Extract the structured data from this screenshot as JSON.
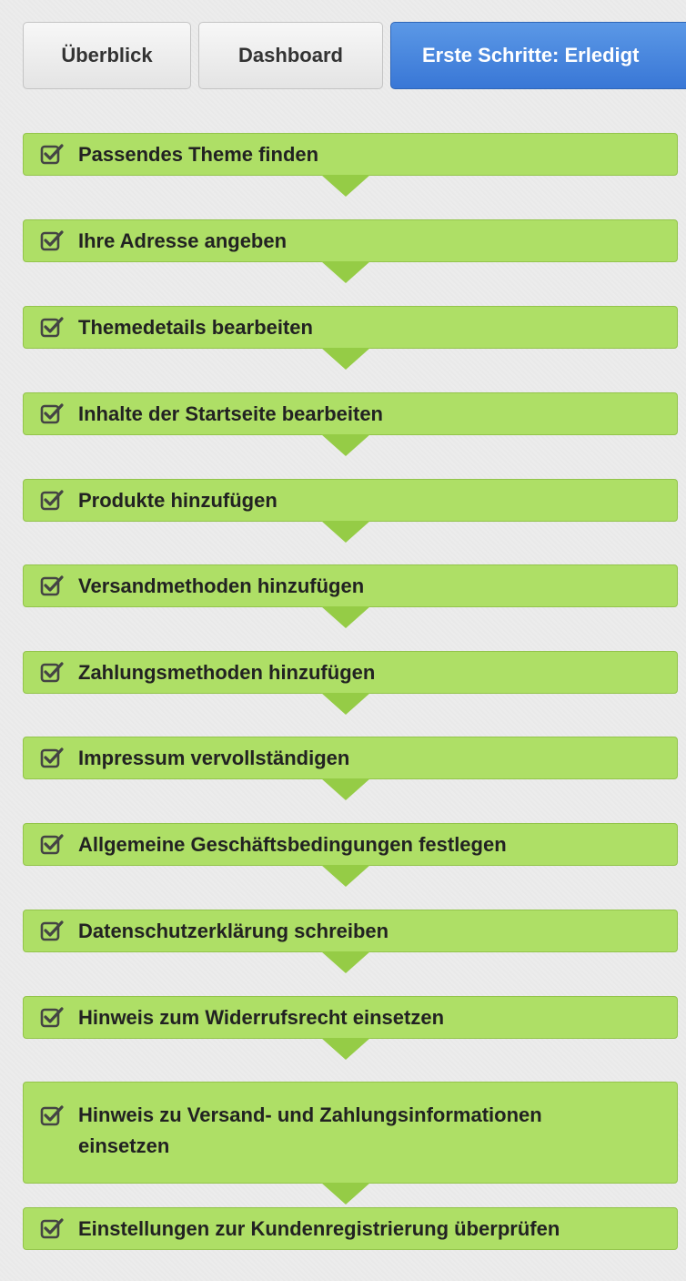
{
  "tabs": [
    {
      "label": "Überblick"
    },
    {
      "label": "Dashboard"
    },
    {
      "label": "Erste Schritte: Erledigt"
    }
  ],
  "steps": [
    {
      "label": "Passendes Theme finden",
      "done": true
    },
    {
      "label": "Ihre Adresse angeben",
      "done": true
    },
    {
      "label": "Themedetails bearbeiten",
      "done": true
    },
    {
      "label": "Inhalte der Startseite bearbeiten",
      "done": true
    },
    {
      "label": "Produkte hinzufügen",
      "done": true
    },
    {
      "label": "Versandmethoden hinzufügen",
      "done": true
    },
    {
      "label": "Zahlungsmethoden hinzufügen",
      "done": true
    },
    {
      "label": "Impressum vervollständigen",
      "done": true
    },
    {
      "label": "Allgemeine Geschäftsbedingungen festlegen",
      "done": true
    },
    {
      "label": "Datenschutzerklärung schreiben",
      "done": true
    },
    {
      "label": "Hinweis zum Widerrufsrecht einsetzen",
      "done": true
    },
    {
      "label": "Hinweis zu Versand- und Zahlungsinformationen einsetzen",
      "done": true
    },
    {
      "label": "Einstellungen zur Kundenregistrierung überprüfen",
      "done": true
    }
  ],
  "colors": {
    "step_fill": "#aedf66",
    "step_border": "#93c44b",
    "active_tab": "#3977d6"
  },
  "icons": {
    "step_icon": "checkbox-checked-icon",
    "connector_icon": "arrow-down-icon"
  }
}
